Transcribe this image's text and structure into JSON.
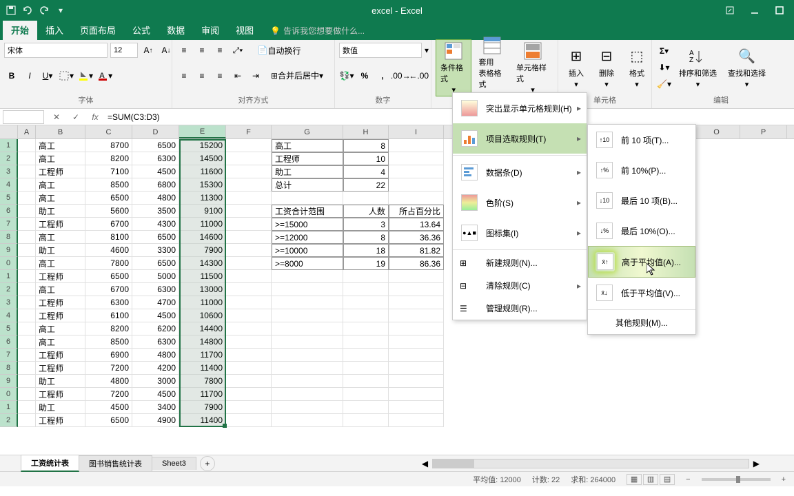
{
  "app": {
    "title": "excel - Excel"
  },
  "tabs": {
    "items": [
      "开始",
      "插入",
      "页面布局",
      "公式",
      "数据",
      "审阅",
      "视图"
    ],
    "tell_me": "告诉我您想要做什么..."
  },
  "ribbon": {
    "font_name": "宋体",
    "font_size": "12",
    "number_format": "数值",
    "wrap_text": "自动换行",
    "merge_center": "合并后居中",
    "groups": {
      "font": "字体",
      "align": "对齐方式",
      "number": "数字",
      "styles": "单元格",
      "editing": "编辑"
    },
    "btns": {
      "cond_format": "条件格式",
      "table_format": "套用\n表格格式",
      "cell_style": "单元格样式",
      "insert": "插入",
      "delete": "删除",
      "format": "格式",
      "sort": "排序和筛选",
      "find": "查找和选择"
    }
  },
  "formula_bar": {
    "name_box": "",
    "formula": "=SUM(C3:D3)"
  },
  "columns": [
    "A",
    "B",
    "C",
    "D",
    "E",
    "F",
    "G",
    "H",
    "I",
    "O",
    "P"
  ],
  "rows": [
    {
      "B": "高工",
      "C": "8700",
      "D": "6500",
      "E": "15200",
      "G": "高工",
      "H": "8"
    },
    {
      "B": "高工",
      "C": "8200",
      "D": "6300",
      "E": "14500",
      "G": "工程师",
      "H": "10"
    },
    {
      "B": "工程师",
      "C": "7100",
      "D": "4500",
      "E": "11600",
      "G": "助工",
      "H": "4"
    },
    {
      "B": "高工",
      "C": "8500",
      "D": "6800",
      "E": "15300",
      "G": "总计",
      "H": "22"
    },
    {
      "B": "高工",
      "C": "6500",
      "D": "4800",
      "E": "11300"
    },
    {
      "B": "助工",
      "C": "5600",
      "D": "3500",
      "E": "9100",
      "G": "工资合计范围",
      "H": "人数",
      "I": "所占百分比"
    },
    {
      "B": "工程师",
      "C": "6700",
      "D": "4300",
      "E": "11000",
      "G": ">=15000",
      "H": "3",
      "I": "13.64"
    },
    {
      "B": "高工",
      "C": "8100",
      "D": "6500",
      "E": "14600",
      "G": ">=12000",
      "H": "8",
      "I": "36.36"
    },
    {
      "B": "助工",
      "C": "4600",
      "D": "3300",
      "E": "7900",
      "G": ">=10000",
      "H": "18",
      "I": "81.82"
    },
    {
      "B": "高工",
      "C": "7800",
      "D": "6500",
      "E": "14300",
      "G": ">=8000",
      "H": "19",
      "I": "86.36"
    },
    {
      "B": "工程师",
      "C": "6500",
      "D": "5000",
      "E": "11500"
    },
    {
      "B": "高工",
      "C": "6700",
      "D": "6300",
      "E": "13000"
    },
    {
      "B": "工程师",
      "C": "6300",
      "D": "4700",
      "E": "11000"
    },
    {
      "B": "工程师",
      "C": "6100",
      "D": "4500",
      "E": "10600"
    },
    {
      "B": "高工",
      "C": "8200",
      "D": "6200",
      "E": "14400"
    },
    {
      "B": "高工",
      "C": "8500",
      "D": "6300",
      "E": "14800"
    },
    {
      "B": "工程师",
      "C": "6900",
      "D": "4800",
      "E": "11700"
    },
    {
      "B": "工程师",
      "C": "7200",
      "D": "4200",
      "E": "11400"
    },
    {
      "B": "助工",
      "C": "4800",
      "D": "3000",
      "E": "7800"
    },
    {
      "B": "工程师",
      "C": "7200",
      "D": "4500",
      "E": "11700"
    },
    {
      "B": "助工",
      "C": "4500",
      "D": "3400",
      "E": "7900"
    },
    {
      "B": "工程师",
      "C": "6500",
      "D": "4900",
      "E": "11400"
    }
  ],
  "menus": {
    "cond_format": {
      "highlight": "突出显示单元格规则(H)",
      "top_bottom": "项目选取规则(T)",
      "data_bars": "数据条(D)",
      "color_scales": "色阶(S)",
      "icon_sets": "图标集(I)",
      "new_rule": "新建规则(N)...",
      "clear": "清除规则(C)",
      "manage": "管理规则(R)..."
    },
    "top_bottom": {
      "top10": "前 10 项(T)...",
      "top10p": "前 10%(P)...",
      "bottom10": "最后 10 项(B)...",
      "bottom10p": "最后 10%(O)...",
      "above": "高于平均值(A)...",
      "below": "低于平均值(V)...",
      "other": "其他规则(M)..."
    }
  },
  "sheets": {
    "tabs": [
      "工资统计表",
      "图书销售统计表",
      "Sheet3"
    ]
  },
  "status": {
    "avg_label": "平均值:",
    "avg_val": "12000",
    "count_label": "计数:",
    "count_val": "22",
    "sum_label": "求和:",
    "sum_val": "264000"
  }
}
